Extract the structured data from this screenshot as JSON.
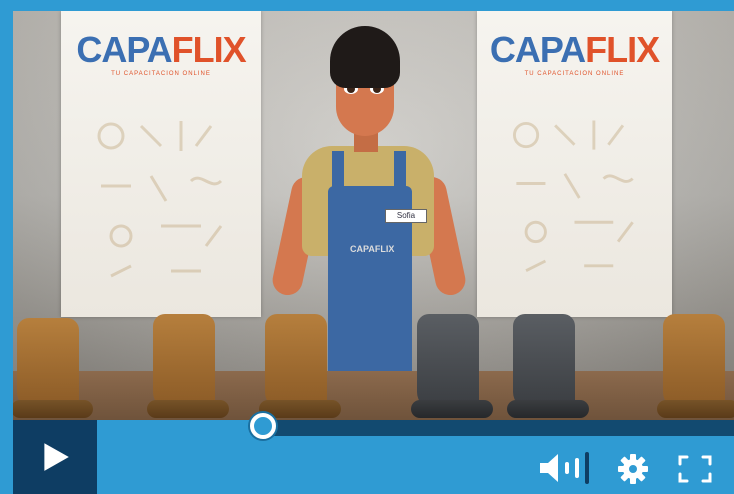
{
  "player": {
    "banner_logo": {
      "part1": "CAPA",
      "part2": "FLIX",
      "tagline": "TU CAPACITACION ONLINE"
    },
    "nametag": "Sofia",
    "shirt_logo": "CAPAFLIX",
    "progress": {
      "fraction": 0.26
    },
    "controls": {
      "play_icon": "play-icon",
      "volume_icon": "volume-icon",
      "settings_icon": "gear-icon",
      "fullscreen_icon": "fullscreen-icon"
    },
    "colors": {
      "frame": "#2f9bd3",
      "track": "#124a70",
      "play_bg": "#0e3d63",
      "brand_blue": "#3b6fb2",
      "brand_orange": "#e0522a"
    }
  }
}
